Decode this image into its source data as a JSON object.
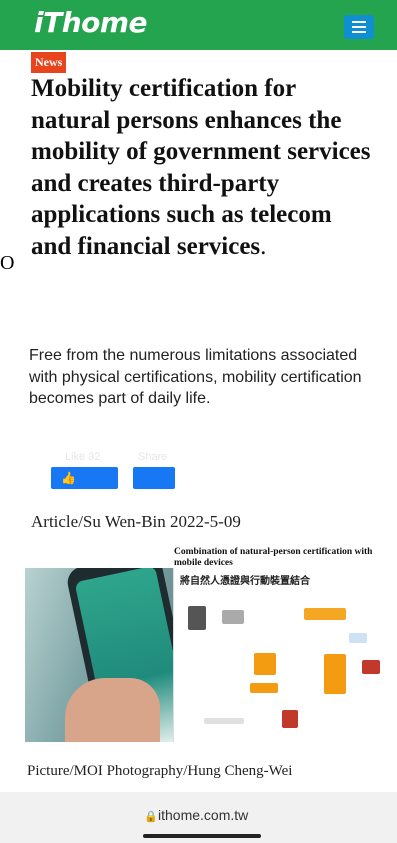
{
  "header": {
    "logo": "iThome",
    "menu_icon": "hamburger-menu-icon",
    "brand_color": "#24a44e",
    "menu_color": "#0f8fd0"
  },
  "article": {
    "badge": "News",
    "badge_color": "#e8451e",
    "headline": "Mobility certification for natural persons enhances the mobility of government services and creates third-party applications such as telecom and financial services",
    "headline_end": ".",
    "edge_char": "O",
    "lead": "Free from the numerous limitations associated with physical certifications, mobility certification becomes part of daily life.",
    "byline": "Article/Su Wen-Bin  2022-5-09"
  },
  "social": {
    "like_label": "Like 32",
    "share_label": "Share",
    "like_icon": "thumbs-up-icon",
    "button_color": "#1877f2"
  },
  "figure": {
    "caption_overlay": "Combination of natural-person certification with mobile devices",
    "diagram_title": "將自然人憑證與行動裝置結合",
    "credits": "Picture/MOI   Photography/Hung Cheng-Wei"
  },
  "browser": {
    "lock_icon": "lock-icon",
    "url": "ithome.com.tw"
  }
}
